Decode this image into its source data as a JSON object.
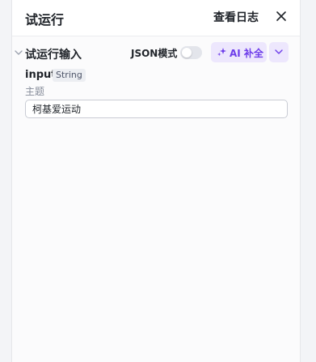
{
  "header": {
    "title": "试运行",
    "view_log_label": "查看日志",
    "close_icon": "close-icon"
  },
  "section": {
    "title": "试运行输入",
    "json_mode_label": "JSON模式",
    "json_mode_enabled": false,
    "ai_button_label": "AI 补全",
    "accent_color": "#6d3cea",
    "ai_button_bg": "#ede7fd"
  },
  "input_field": {
    "name": "input",
    "type": "String",
    "description": "主题",
    "value": "柯基爱运动"
  }
}
